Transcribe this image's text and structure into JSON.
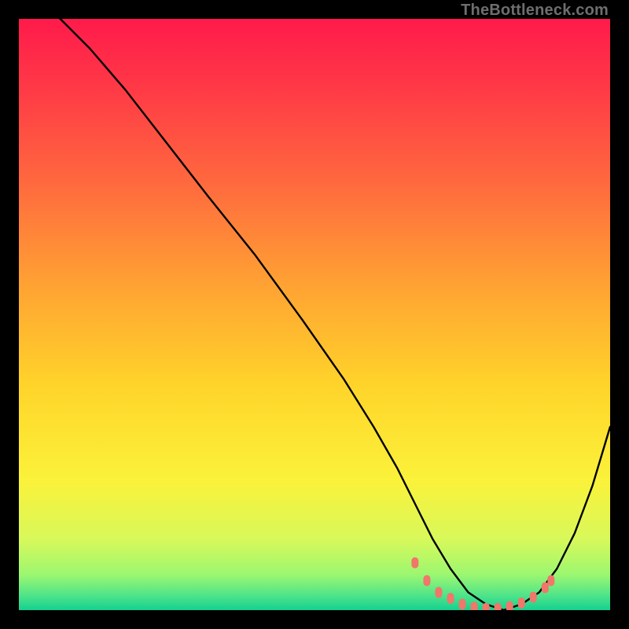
{
  "watermark": "TheBottleneck.com",
  "colors": {
    "frame_bg": "#000000",
    "curve": "#000000",
    "marker": "#f0776a",
    "gradient_stops": [
      {
        "offset": 0.0,
        "color": "#ff1a4b"
      },
      {
        "offset": 0.12,
        "color": "#ff3a46"
      },
      {
        "offset": 0.28,
        "color": "#ff6a3e"
      },
      {
        "offset": 0.45,
        "color": "#ffa233"
      },
      {
        "offset": 0.62,
        "color": "#ffd42a"
      },
      {
        "offset": 0.78,
        "color": "#fbf23a"
      },
      {
        "offset": 0.88,
        "color": "#d8f85a"
      },
      {
        "offset": 0.94,
        "color": "#9cf770"
      },
      {
        "offset": 0.975,
        "color": "#4fe48a"
      },
      {
        "offset": 1.0,
        "color": "#14d18f"
      }
    ]
  },
  "chart_data": {
    "type": "line",
    "title": "",
    "xlabel": "",
    "ylabel": "",
    "xlim": [
      0,
      100
    ],
    "ylim": [
      0,
      100
    ],
    "series": [
      {
        "name": "curve",
        "x": [
          0,
          2,
          5,
          8,
          12,
          18,
          25,
          32,
          40,
          48,
          55,
          60,
          64,
          67,
          70,
          73,
          76,
          79,
          82,
          85,
          88,
          91,
          94,
          97,
          100
        ],
        "y": [
          106,
          104,
          102,
          99,
          95,
          88,
          79,
          70,
          60,
          49,
          39,
          31,
          24,
          18,
          12,
          7,
          3,
          1,
          0,
          1,
          3,
          7,
          13,
          21,
          31
        ]
      }
    ],
    "markers": {
      "name": "optimal-band",
      "points": [
        {
          "x": 67,
          "y": 8
        },
        {
          "x": 69,
          "y": 5
        },
        {
          "x": 71,
          "y": 3
        },
        {
          "x": 73,
          "y": 2
        },
        {
          "x": 75,
          "y": 1
        },
        {
          "x": 77,
          "y": 0.5
        },
        {
          "x": 79,
          "y": 0.3
        },
        {
          "x": 81,
          "y": 0.3
        },
        {
          "x": 83,
          "y": 0.6
        },
        {
          "x": 85,
          "y": 1.2
        },
        {
          "x": 87,
          "y": 2.2
        },
        {
          "x": 89,
          "y": 3.8
        },
        {
          "x": 90,
          "y": 5
        }
      ]
    }
  }
}
